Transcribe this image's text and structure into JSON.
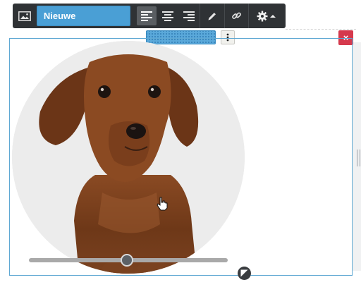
{
  "toolbar": {
    "image_icon": "image-icon",
    "new_image_label": "Nieuwe afbeelding",
    "align_left_icon": "align-left-icon",
    "align_center_icon": "align-center-icon",
    "align_right_icon": "align-right-icon",
    "edit_icon": "pencil-icon",
    "link_icon": "link-icon",
    "settings_icon": "gear-icon",
    "settings_caret_icon": "caret-up-icon",
    "active_alignment": "left"
  },
  "selection": {
    "drag_handle": "drag-handle",
    "more_icon": "vertical-dots-icon",
    "close_label": "×",
    "resize_icon": "resize-icon"
  },
  "image": {
    "subject": "dachshund photo",
    "shape": "circle",
    "zoom_slider_value": 0.5
  },
  "colors": {
    "toolbar_bg": "#2f3235",
    "accent_blue": "#4a9fd5",
    "frame_border": "#5fa8d3",
    "close_red": "#d5394d"
  }
}
